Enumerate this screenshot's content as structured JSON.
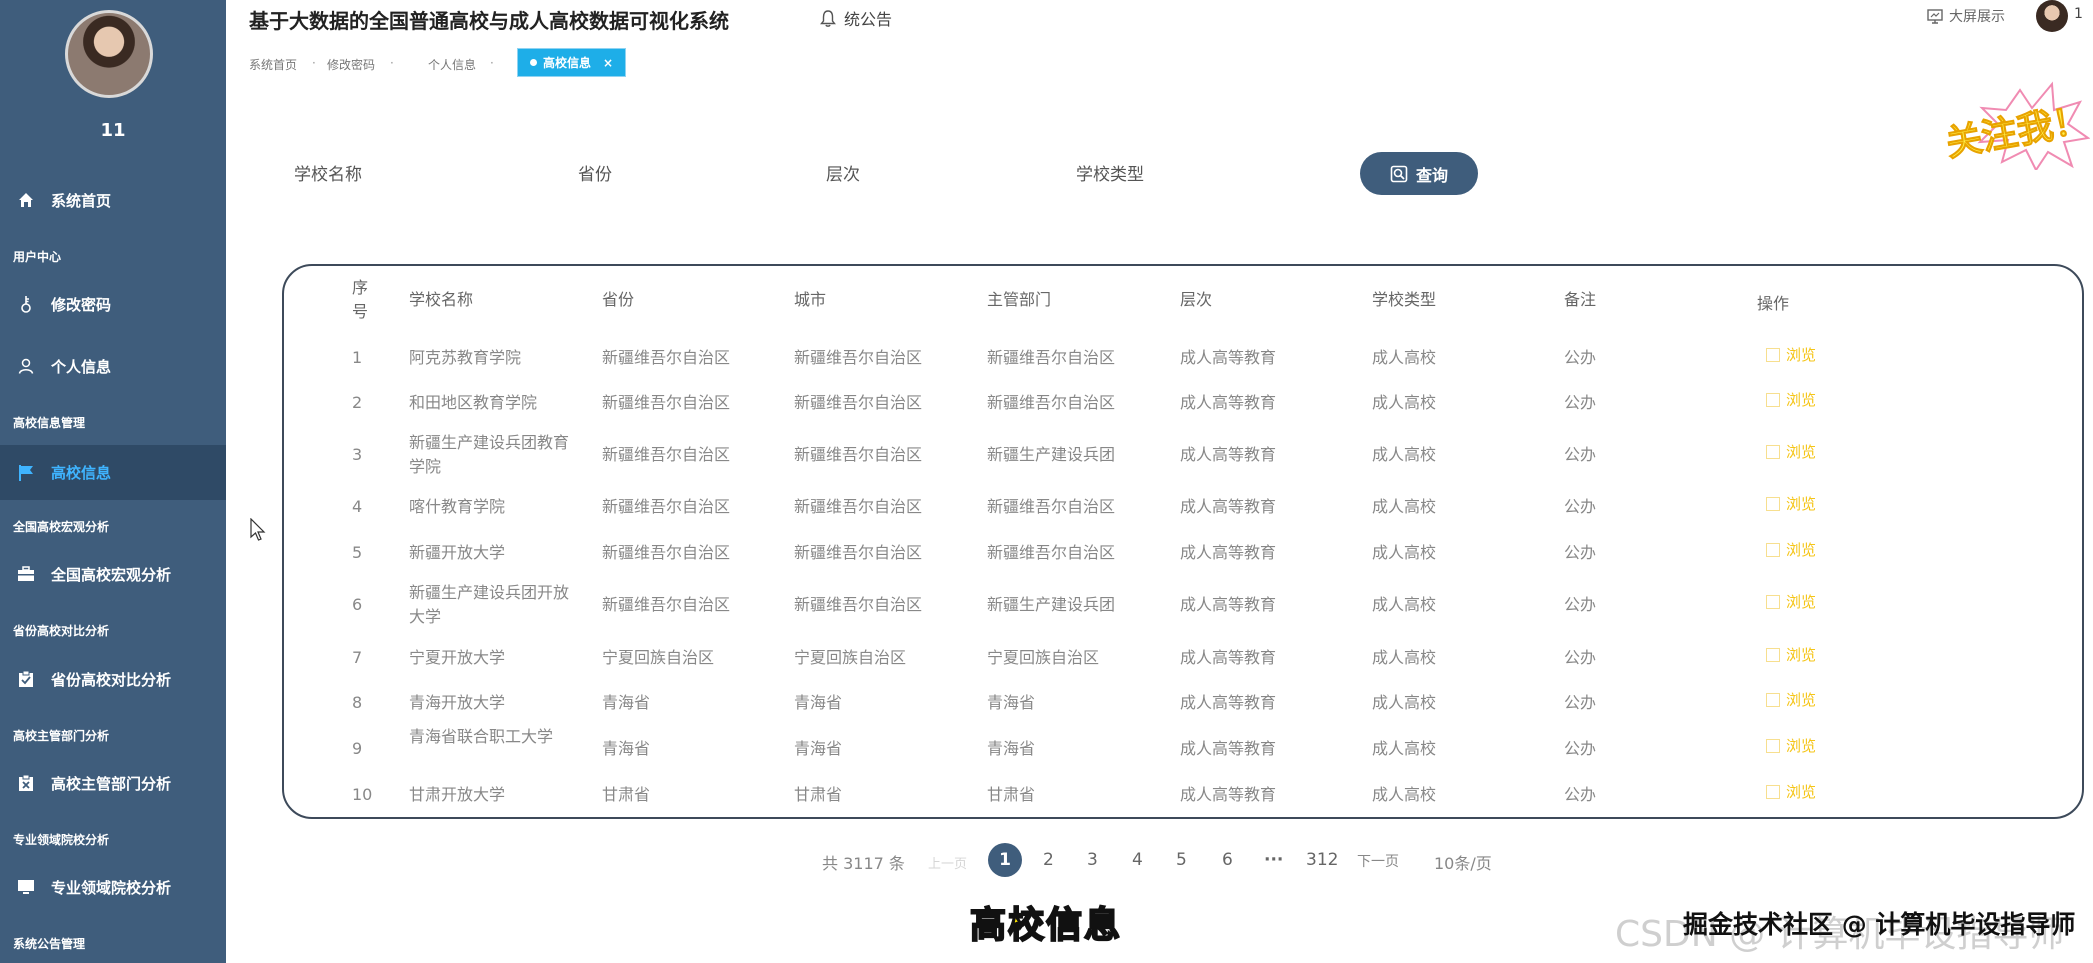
{
  "app": {
    "title": "基于大数据的全国普通高校与成人高校数据可视化系统",
    "notice": "统公告",
    "bigscreen": "大屏展示",
    "top_user": "1"
  },
  "sidebar": {
    "username": "11",
    "items": [
      {
        "label": "系统首页"
      },
      {
        "group": "用户中心"
      },
      {
        "label": "修改密码"
      },
      {
        "label": "个人信息"
      },
      {
        "group": "高校信息管理"
      },
      {
        "label": "高校信息"
      },
      {
        "group": "全国高校宏观分析"
      },
      {
        "label": "全国高校宏观分析"
      },
      {
        "group": "省份高校对比分析"
      },
      {
        "label": "省份高校对比分析"
      },
      {
        "group": "高校主管部门分析"
      },
      {
        "label": "高校主管部门分析"
      },
      {
        "group": "专业领域院校分析"
      },
      {
        "label": "专业领域院校分析"
      },
      {
        "group": "系统公告管理"
      }
    ]
  },
  "breadcrumb": {
    "items": [
      "系统首页",
      "修改密码",
      "个人信息"
    ],
    "active": "高校信息",
    "close": "×"
  },
  "sticker_text": "关注我！",
  "search": {
    "labels": [
      "学校名称",
      "省份",
      "层次",
      "学校类型"
    ],
    "button": "查询"
  },
  "table": {
    "headers": [
      "序号",
      "学校名称",
      "省份",
      "城市",
      "主管部门",
      "层次",
      "学校类型",
      "备注",
      "操作"
    ],
    "action_label": "浏览",
    "rows": [
      [
        "1",
        "阿克苏教育学院",
        "新疆维吾尔自治区",
        "新疆维吾尔自治区",
        "新疆维吾尔自治区",
        "成人高等教育",
        "成人高校",
        "公办"
      ],
      [
        "2",
        "和田地区教育学院",
        "新疆维吾尔自治区",
        "新疆维吾尔自治区",
        "新疆维吾尔自治区",
        "成人高等教育",
        "成人高校",
        "公办"
      ],
      [
        "3",
        "新疆生产建设兵团教育学院",
        "新疆维吾尔自治区",
        "新疆维吾尔自治区",
        "新疆生产建设兵团",
        "成人高等教育",
        "成人高校",
        "公办"
      ],
      [
        "4",
        "喀什教育学院",
        "新疆维吾尔自治区",
        "新疆维吾尔自治区",
        "新疆维吾尔自治区",
        "成人高等教育",
        "成人高校",
        "公办"
      ],
      [
        "5",
        "新疆开放大学",
        "新疆维吾尔自治区",
        "新疆维吾尔自治区",
        "新疆维吾尔自治区",
        "成人高等教育",
        "成人高校",
        "公办"
      ],
      [
        "6",
        "新疆生产建设兵团开放大学",
        "新疆维吾尔自治区",
        "新疆维吾尔自治区",
        "新疆生产建设兵团",
        "成人高等教育",
        "成人高校",
        "公办"
      ],
      [
        "7",
        "宁夏开放大学",
        "宁夏回族自治区",
        "宁夏回族自治区",
        "宁夏回族自治区",
        "成人高等教育",
        "成人高校",
        "公办"
      ],
      [
        "8",
        "青海开放大学",
        "青海省",
        "青海省",
        "青海省",
        "成人高等教育",
        "成人高校",
        "公办"
      ],
      [
        "9",
        "青海省联合职工大学",
        "青海省",
        "青海省",
        "青海省",
        "成人高等教育",
        "成人高校",
        "公办"
      ],
      [
        "10",
        "甘肃开放大学",
        "甘肃省",
        "甘肃省",
        "甘肃省",
        "成人高等教育",
        "成人高校",
        "公办"
      ]
    ]
  },
  "pagination": {
    "total": "共 3117 条",
    "prev": "上一页",
    "current": "1",
    "pages": [
      "2",
      "3",
      "4",
      "5",
      "6"
    ],
    "ellipsis": "···",
    "last": "312",
    "next": "下一页",
    "page_size": "10条/页"
  },
  "overlay": {
    "caption": "高校信息",
    "watermark": "掘金技术社区 @ 计算机毕设指导师",
    "csdn": "CSDN @ 计算机毕设指导师"
  },
  "colors": {
    "sidebar": "#3f5d7c",
    "sidebar_active": "#2f4a66",
    "accent": "#1eaee8",
    "browse": "#f5c518"
  }
}
